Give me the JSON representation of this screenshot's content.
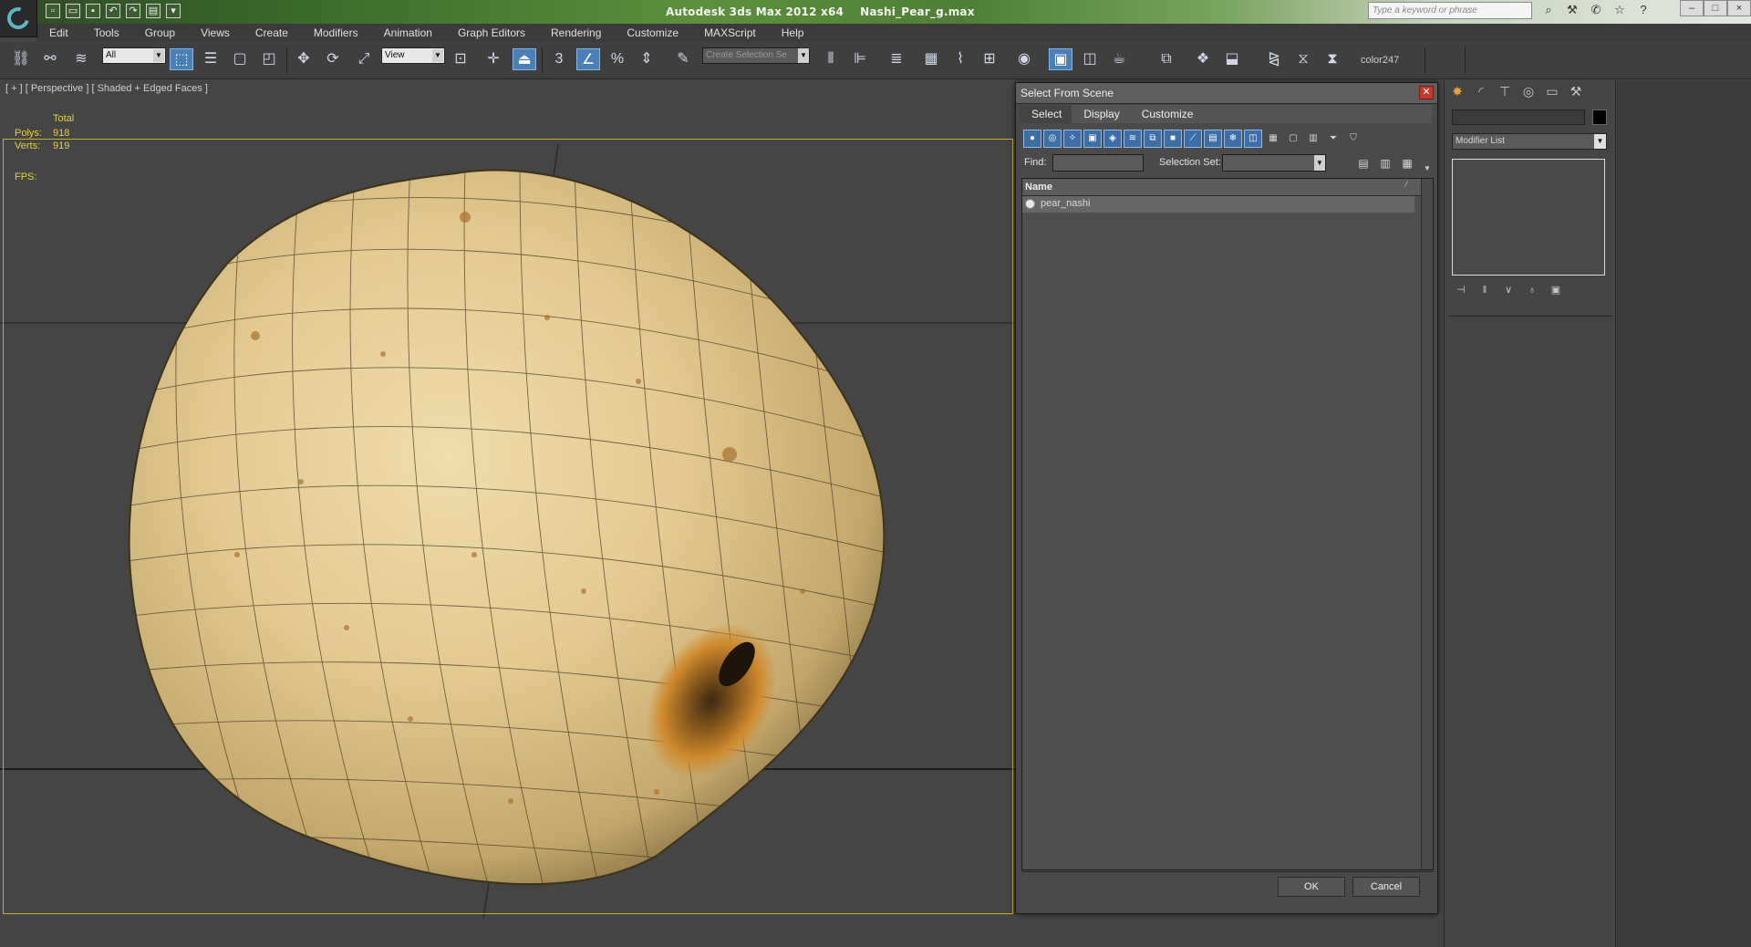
{
  "titlebar": {
    "app_title": "Autodesk 3ds Max  2012 x64",
    "file_name": "Nashi_Pear_g.max",
    "search_placeholder": "Type a keyword or phrase"
  },
  "menu": [
    "Edit",
    "Tools",
    "Group",
    "Views",
    "Create",
    "Modifiers",
    "Animation",
    "Graph Editors",
    "Rendering",
    "Customize",
    "MAXScript",
    "Help"
  ],
  "toolbar": {
    "selection_filter": "All",
    "reference_coord": "View",
    "named_selection_placeholder": "Create Selection Se",
    "snap_label": "3",
    "color_label": "color247"
  },
  "viewport": {
    "label": "[ + ] [ Perspective ] [ Shaded + Edged Faces ]",
    "stats": {
      "total_label": "Total",
      "polys_label": "Polys:",
      "polys_value": "918",
      "verts_label": "Verts:",
      "verts_value": "919",
      "fps_label": "FPS:"
    }
  },
  "dialog": {
    "title": "Select From Scene",
    "menu": [
      "Select",
      "Display",
      "Customize"
    ],
    "find_label": "Find:",
    "selection_set_label": "Selection Set:",
    "column_name": "Name",
    "items": [
      "pear_nashi"
    ],
    "ok_label": "OK",
    "cancel_label": "Cancel"
  },
  "command_panel": {
    "modifier_list": "Modifier List"
  },
  "colors": {
    "viewport_bg": "#454545",
    "active_frame": "#c8b12a",
    "stats_text": "#e6d23a",
    "pear_skin": "#d9c48f",
    "accent_blue": "#4a7fb8"
  }
}
